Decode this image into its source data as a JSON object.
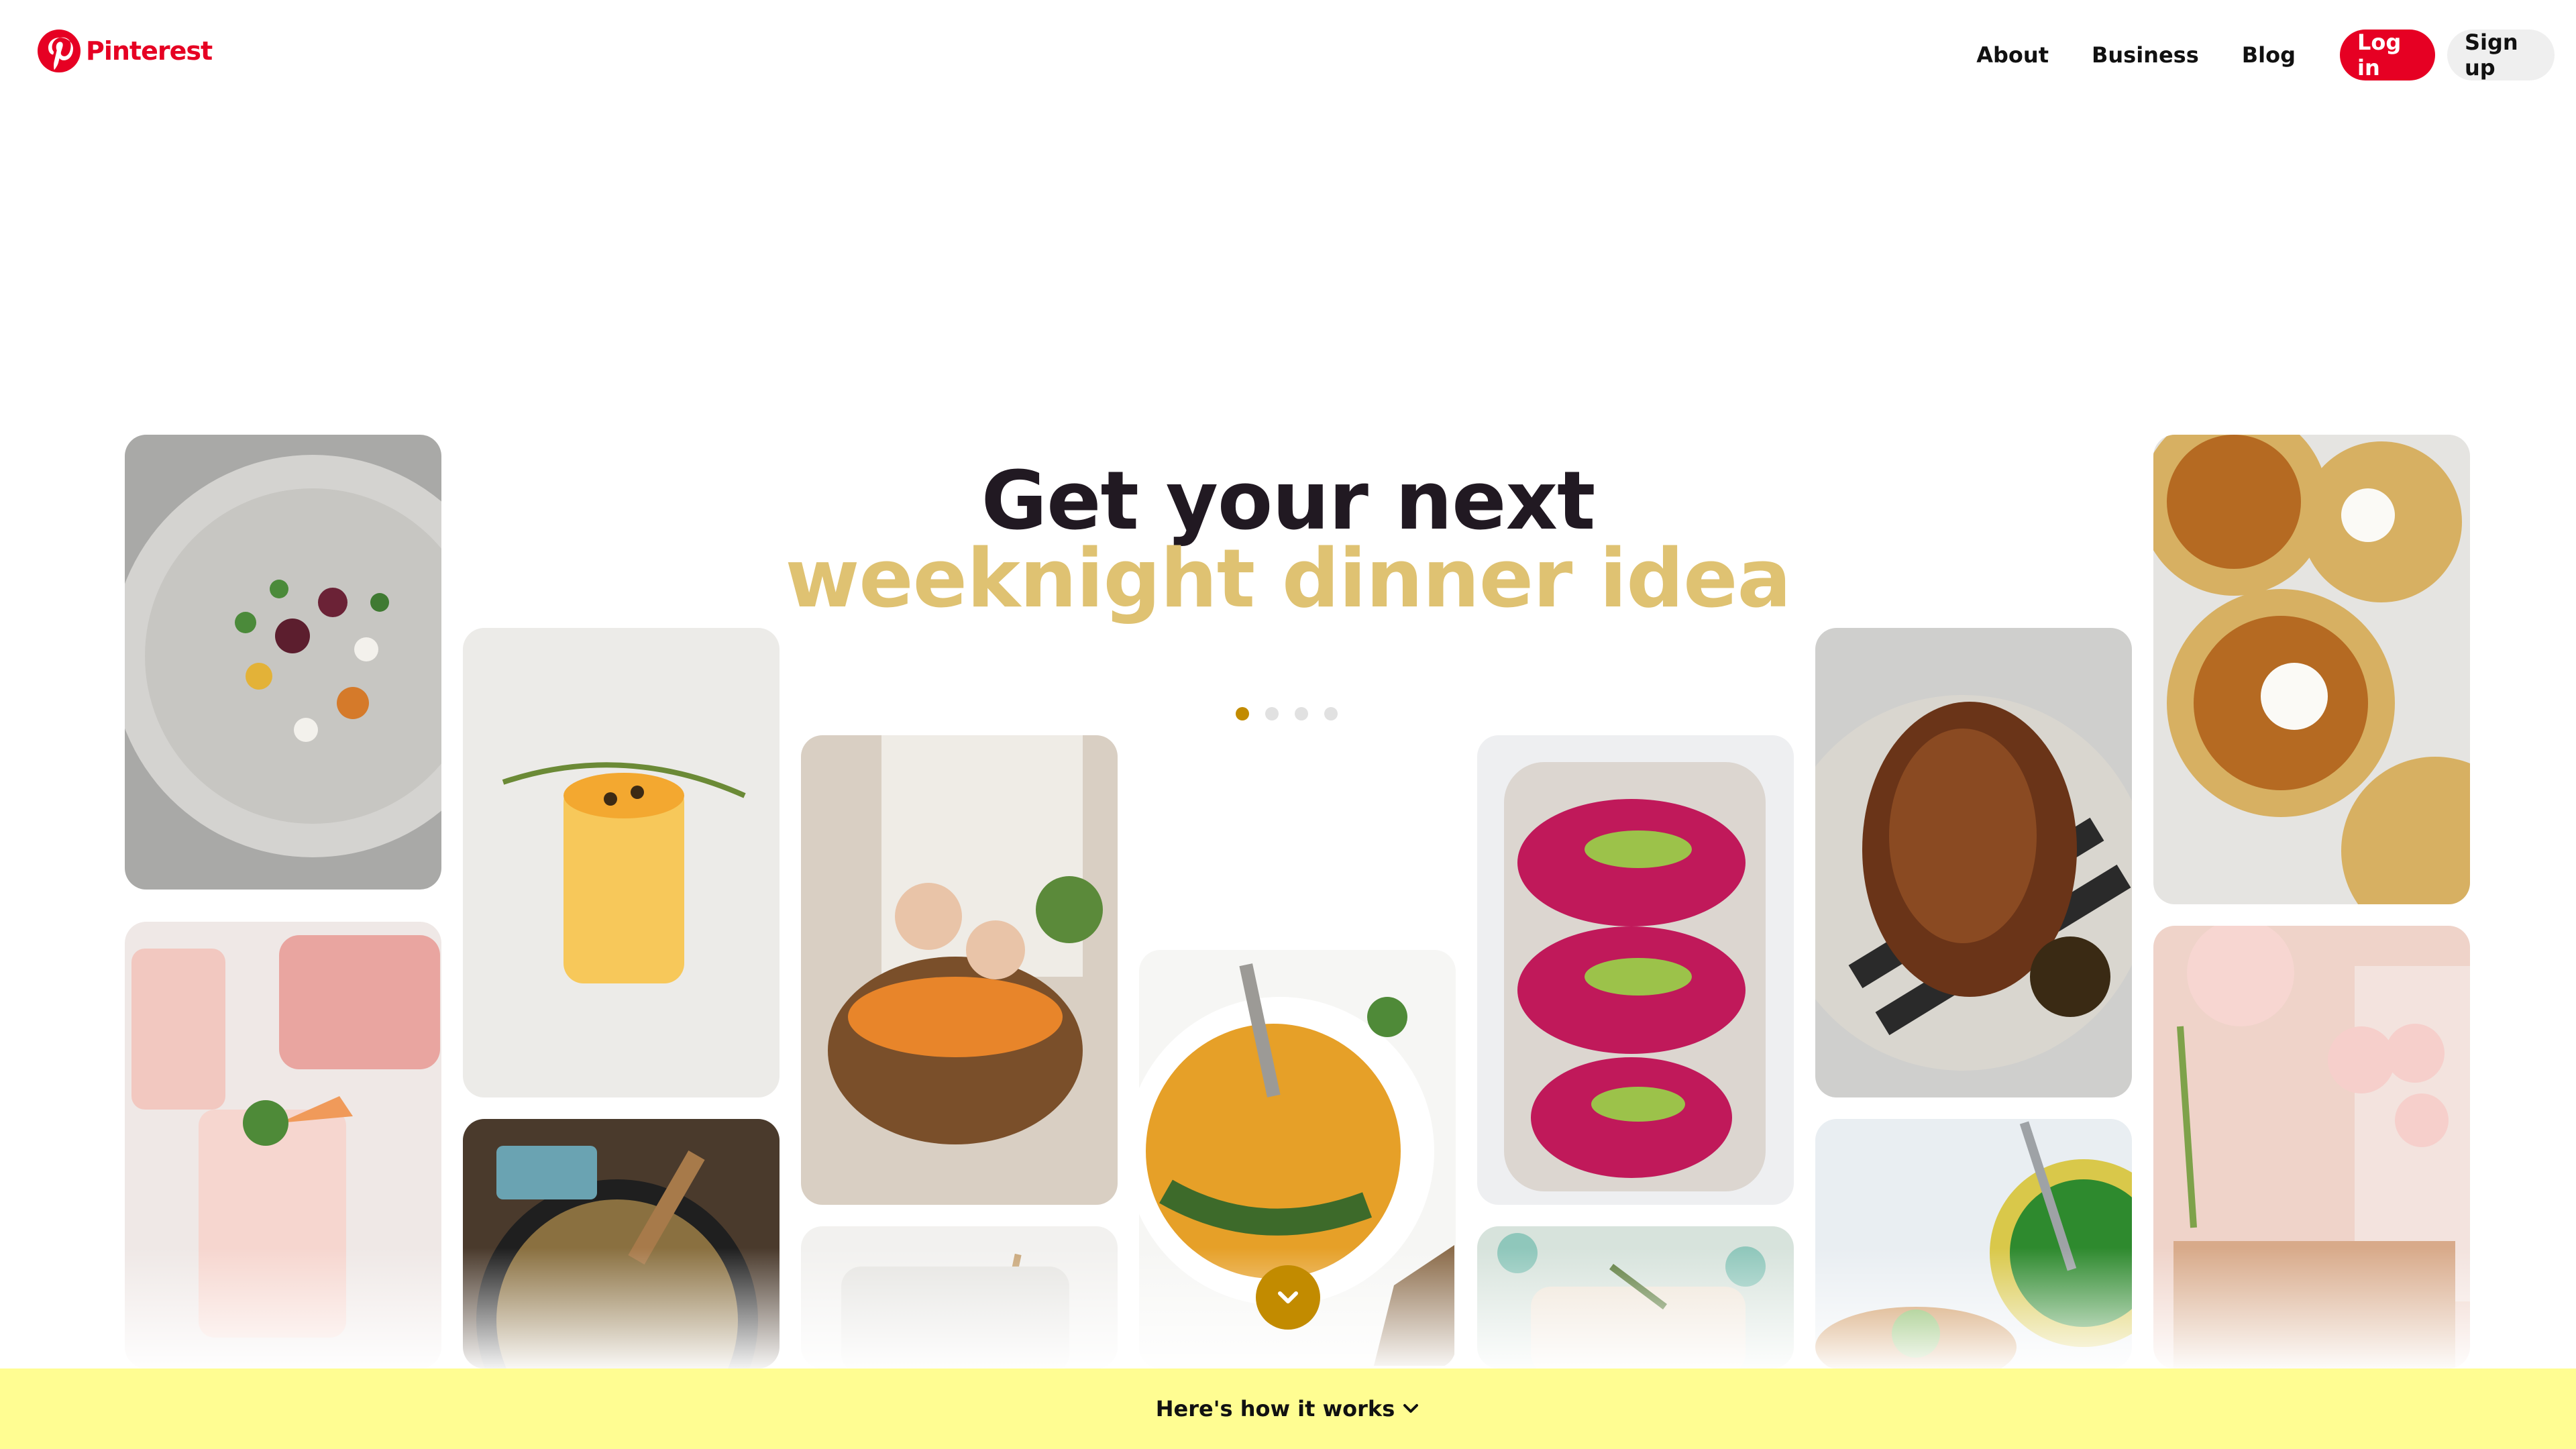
{
  "brand": {
    "name": "Pinterest",
    "color": "#e60023"
  },
  "nav": {
    "links": [
      "About",
      "Business",
      "Blog"
    ],
    "login_label": "Log in",
    "signup_label": "Sign up"
  },
  "hero": {
    "line1": "Get your next",
    "line2": "weeknight dinner idea",
    "line2_color": "#dfc272",
    "carousel_dots": 4,
    "active_dot": 1
  },
  "pins": [
    {
      "name": "beet-salad-plate"
    },
    {
      "name": "peach-cocktail"
    },
    {
      "name": "grilled-citrus-drink"
    },
    {
      "name": "skillet-frittata"
    },
    {
      "name": "hands-garnishing-bowl"
    },
    {
      "name": "glass-with-straw"
    },
    {
      "name": "squash-hummus-bowl"
    },
    {
      "name": "beet-hummus-avocado-toast"
    },
    {
      "name": "wrapped-herb-bundle"
    },
    {
      "name": "roast-chicken-plate"
    },
    {
      "name": "pea-bowl-toast"
    },
    {
      "name": "chickpea-flatbreads"
    },
    {
      "name": "pink-party-decor"
    }
  ],
  "footer": {
    "label": "Here's how it works",
    "background": "#fffd92"
  },
  "icons": {
    "logo": "pinterest-logo-icon",
    "scroll_down": "chevron-down-icon",
    "footer_chevron": "chevron-down-icon"
  }
}
